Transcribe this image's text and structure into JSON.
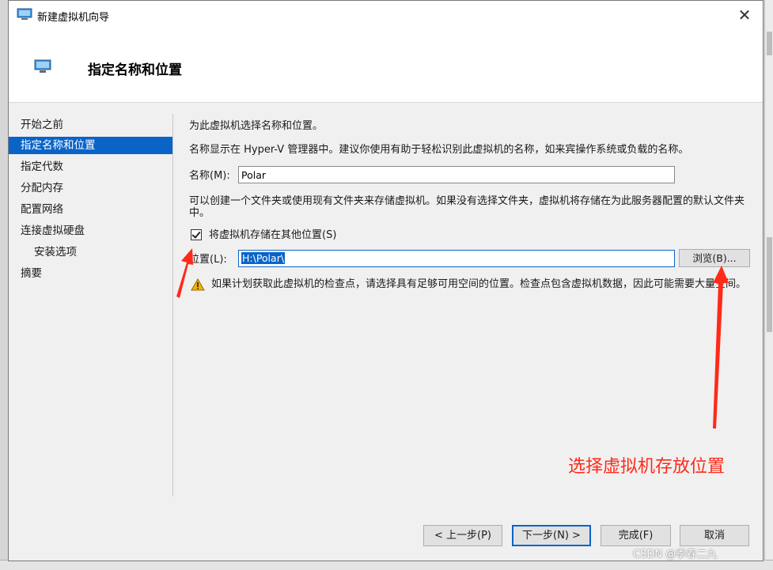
{
  "window": {
    "title": "新建虚拟机向导",
    "close_glyph": "✕"
  },
  "header": {
    "title": "指定名称和位置"
  },
  "nav": {
    "items": [
      {
        "label": "开始之前"
      },
      {
        "label": "指定名称和位置"
      },
      {
        "label": "指定代数"
      },
      {
        "label": "分配内存"
      },
      {
        "label": "配置网络"
      },
      {
        "label": "连接虚拟硬盘"
      },
      {
        "label": "安装选项"
      },
      {
        "label": "摘要"
      }
    ],
    "active_index": 1
  },
  "content": {
    "intro": "为此虚拟机选择名称和位置。",
    "name_hint": "名称显示在 Hyper-V 管理器中。建议你使用有助于轻松识别此虚拟机的名称，如来宾操作系统或负载的名称。",
    "name_label": "名称(M):",
    "name_value": "Polar",
    "folder_hint": "可以创建一个文件夹或使用现有文件夹来存储虚拟机。如果没有选择文件夹，虚拟机将存储在为此服务器配置的默认文件夹中。",
    "store_checkbox_label": "将虚拟机存储在其他位置(S)",
    "store_checked": true,
    "location_label": "位置(L):",
    "location_value": "H:\\Polar\\",
    "browse_label": "浏览(B)...",
    "warning_text": "如果计划获取此虚拟机的检查点，请选择具有足够可用空间的位置。检查点包含虚拟机数据，因此可能需要大量空间。"
  },
  "footer": {
    "prev_label": "< 上一步(P)",
    "next_label": "下一步(N) >",
    "finish_label": "完成(F)",
    "cancel_label": "取消"
  },
  "annotation": {
    "text": "选择虚拟机存放位置",
    "color": "#ff2a1a"
  },
  "watermark": "CSDN @季春二九",
  "colors": {
    "accent": "#0a64c8",
    "warning": "#e0a000"
  },
  "icons": {
    "title": "monitor-icon",
    "header": "monitor-icon",
    "close": "close-icon",
    "warning": "warning-icon"
  }
}
